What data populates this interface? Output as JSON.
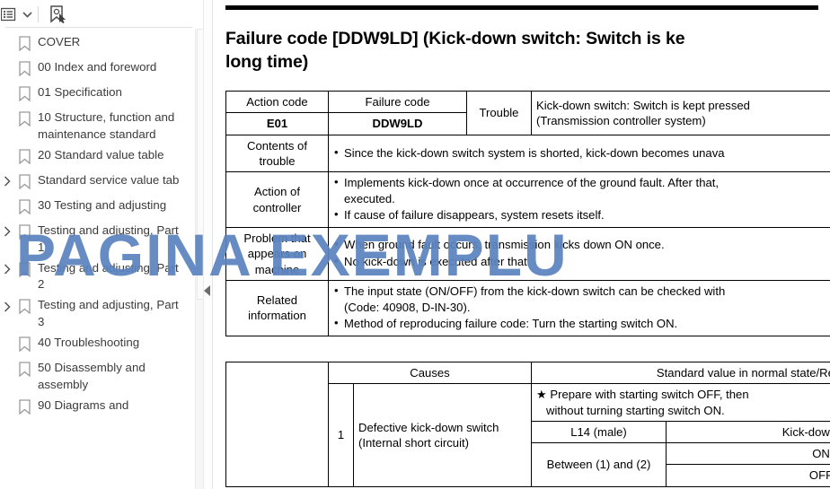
{
  "sidebar": {
    "toolbar": {
      "options_label": "Bookmark options",
      "caret_label": "Open options menu",
      "bookmark_tool_label": "Select bookmark"
    },
    "items": [
      {
        "label": "COVER",
        "expandable": false
      },
      {
        "label": "00 Index and foreword",
        "expandable": false
      },
      {
        "label": "01 Specification",
        "expandable": false
      },
      {
        "label": "10 Structure, function and maintenance standard",
        "expandable": false
      },
      {
        "label": "20 Standard value table",
        "expandable": false
      },
      {
        "label": "Standard service value tab",
        "expandable": true
      },
      {
        "label": "30 Testing and adjusting",
        "expandable": false
      },
      {
        "label": "Testing and adjusting, Part 1",
        "expandable": true
      },
      {
        "label": "Testing and adjusting, Part 2",
        "expandable": true
      },
      {
        "label": "Testing and adjusting, Part 3",
        "expandable": true
      },
      {
        "label": "40 Troubleshooting",
        "expandable": false
      },
      {
        "label": "50 Disassembly and assembly",
        "expandable": false
      },
      {
        "label": "90 Diagrams and",
        "expandable": false
      }
    ]
  },
  "document": {
    "title_line1": "Failure code [DDW9LD] (Kick-down switch: Switch is ke",
    "title_line2": "long time)",
    "table1": {
      "h_action_code": "Action code",
      "h_failure_code": "Failure code",
      "h_trouble": "Trouble",
      "v_action_code": "E01",
      "v_failure_code": "DDW9LD",
      "trouble_line1": "Kick-down switch: Switch is kept pressed",
      "trouble_line2": "(Transmission controller system)",
      "row_contents_label_l1": "Contents of",
      "row_contents_label_l2": "trouble",
      "row_contents_bullets": [
        "Since the kick-down switch system is shorted, kick-down becomes unava"
      ],
      "row_action_label_l1": "Action of",
      "row_action_label_l2": "controller",
      "row_action_bullets": [
        "Implements kick-down once at occurrence of the ground fault. After that,",
        "executed.",
        "If cause of failure disappears, system resets itself."
      ],
      "row_problem_label_l1": "Problem that",
      "row_problem_label_l2": "appears on",
      "row_problem_label_l3": "machine",
      "row_problem_bullets": [
        "When ground fault occurs, transmission kicks down ON once.",
        "No kick-down is executed after that."
      ],
      "row_related_label_l1": "Related",
      "row_related_label_l2": "information",
      "row_related_bullets": [
        "The input state (ON/OFF) from the kick-down switch can be checked with",
        "(Code: 40908, D-IN-30).",
        "Method of reproducing failure code: Turn the starting switch ON."
      ]
    },
    "table2": {
      "h_causes": "Causes",
      "h_standard": "Standard value in normal state/Rema",
      "note_line1": "★ Prepare with starting switch OFF, then",
      "note_line2": "without turning starting switch ON.",
      "sub_h_connector": "L14 (male)",
      "sub_h_condition": "Kick-down swit",
      "cause_number": "1",
      "cause_line1": "Defective kick-down switch",
      "cause_line2": "(Internal short circuit)",
      "measure_point": "Between (1) and (2)",
      "state_on": "ON",
      "state_off": "OFF"
    }
  },
  "watermark": {
    "text": "PAGINA EXEMPLU",
    "color": "#5b84bf"
  }
}
